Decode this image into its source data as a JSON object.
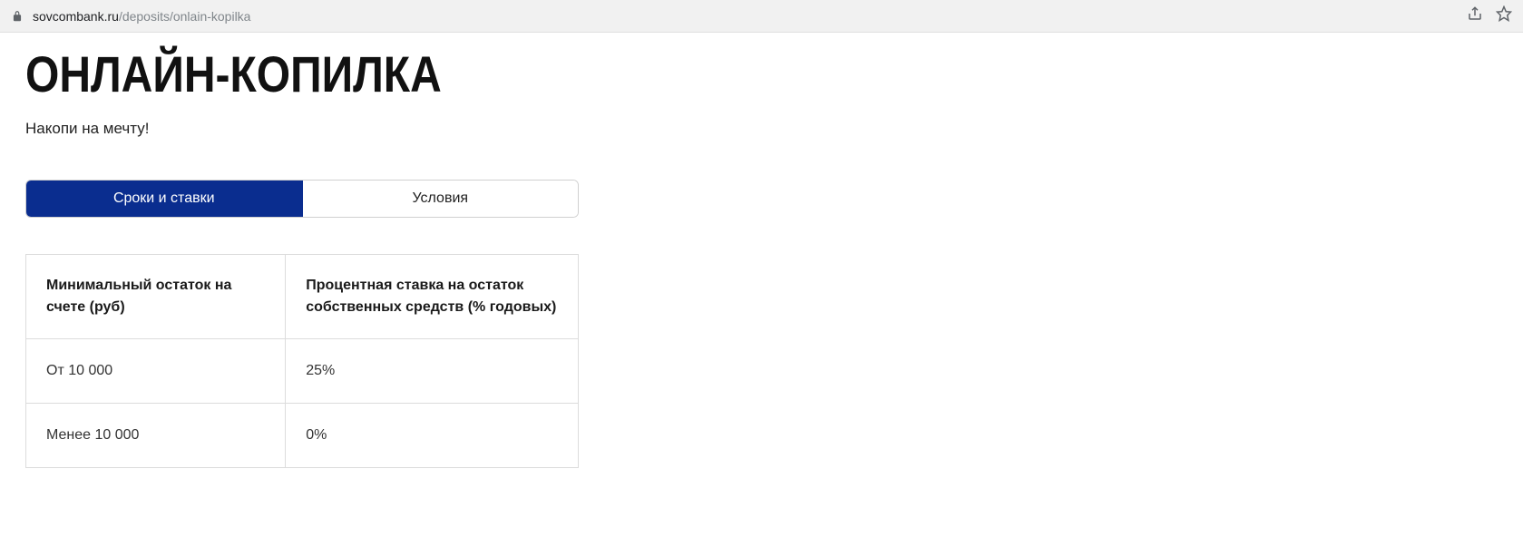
{
  "browser": {
    "url_host": "sovcombank.ru",
    "url_path": "/deposits/onlain-kopilka"
  },
  "page": {
    "title": "ОНЛАЙН-КОПИЛКА",
    "subtitle": "Накопи на мечту!"
  },
  "tabs": [
    {
      "label": "Сроки и ставки",
      "active": true
    },
    {
      "label": "Условия",
      "active": false
    }
  ],
  "table": {
    "headers": [
      "Минимальный остаток на счете (руб)",
      "Процентная ставка на остаток собственных средств (% годовых)"
    ],
    "rows": [
      {
        "balance": "От 10 000",
        "rate": "25%"
      },
      {
        "balance": "Менее 10 000",
        "rate": "0%"
      }
    ]
  }
}
